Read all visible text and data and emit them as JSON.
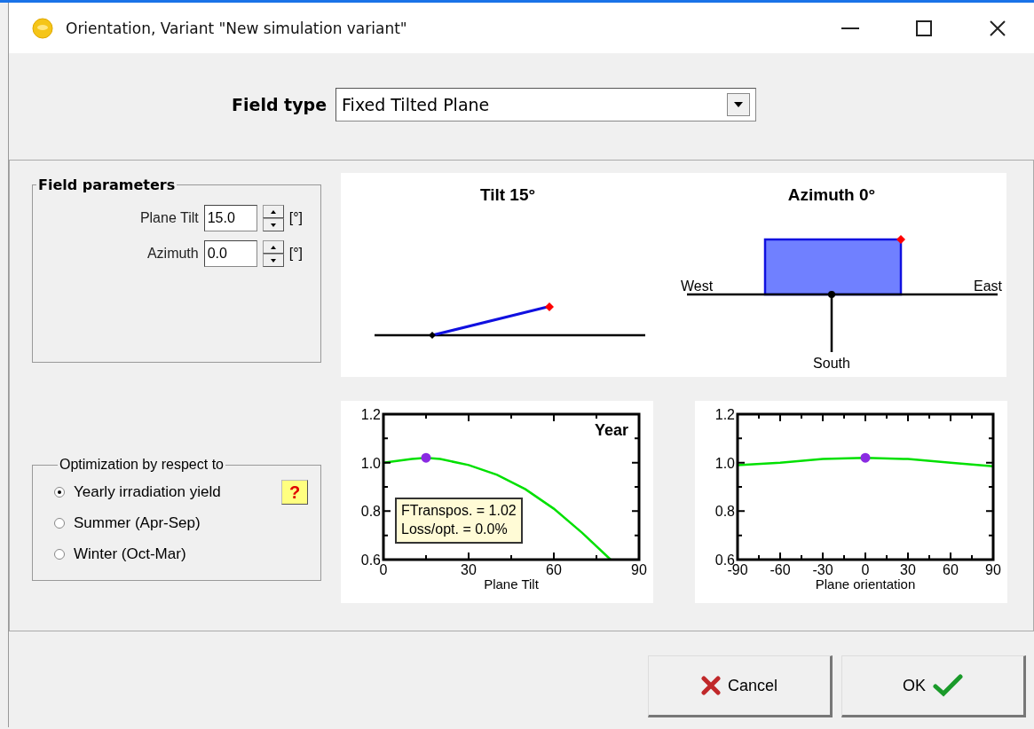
{
  "window": {
    "title": "Orientation, Variant \"New simulation variant\""
  },
  "field_type": {
    "label": "Field type",
    "value": "Fixed Tilted Plane"
  },
  "field_parameters": {
    "title": "Field parameters",
    "rows": [
      {
        "label": "Plane Tilt",
        "value": "15.0",
        "unit": "[°]"
      },
      {
        "label": "Azimuth",
        "value": "0.0",
        "unit": "[°]"
      }
    ]
  },
  "optimization": {
    "title": "Optimization by respect to",
    "help": "?",
    "options": [
      {
        "label": "Yearly irradiation yield",
        "selected": true
      },
      {
        "label": "Summer (Apr-Sep)",
        "selected": false
      },
      {
        "label": "Winter (Oct-Mar)",
        "selected": false
      }
    ]
  },
  "tilt_diagram": {
    "title": "Tilt 15°"
  },
  "azimuth_diagram": {
    "title": "Azimuth 0°",
    "west": "West",
    "east": "East",
    "south": "South"
  },
  "tilt_chart": {
    "tag": "Year",
    "info": [
      "FTranspos. = 1.02",
      "Loss/opt. = 0.0%"
    ],
    "chart_data": {
      "type": "line",
      "xlabel": "Plane Tilt",
      "x": [
        0,
        10,
        15,
        20,
        30,
        40,
        50,
        60,
        70,
        80
      ],
      "series": [
        {
          "color": "#00e000",
          "values": [
            1.0,
            1.015,
            1.02,
            1.015,
            0.99,
            0.95,
            0.89,
            0.81,
            0.71,
            0.6
          ]
        }
      ],
      "xlim": [
        0,
        90
      ],
      "ylim": [
        0.6,
        1.2
      ],
      "xticks": [
        0,
        30,
        60,
        90
      ],
      "yticks": [
        {
          "value": 0.6,
          "label": "0.6"
        },
        {
          "value": 0.8,
          "label": "0.8"
        },
        {
          "value": 1.0,
          "label": "1.0"
        },
        {
          "value": 1.2,
          "label": "1.2"
        }
      ]
    }
  },
  "azimuth_chart": {
    "chart_data": {
      "type": "line",
      "xlabel": "Plane orientation",
      "x": [
        -90,
        -60,
        -30,
        0,
        30,
        60,
        90
      ],
      "series": [
        {
          "color": "#00e000",
          "values": [
            0.99,
            1.0,
            1.015,
            1.02,
            1.015,
            1.0,
            0.985
          ]
        }
      ],
      "xlim": [
        -90,
        90
      ],
      "ylim": [
        0.6,
        1.2
      ],
      "xticks": [
        -90,
        -60,
        -30,
        0,
        30,
        60,
        90
      ],
      "yticks": [
        {
          "value": 0.6,
          "label": "0.6"
        },
        {
          "value": 0.8,
          "label": "0.8"
        },
        {
          "value": 1.0,
          "label": "1.0"
        },
        {
          "value": 1.2,
          "label": "1.2"
        }
      ]
    }
  },
  "buttons": [
    {
      "label": "Cancel",
      "kind": "cancel"
    },
    {
      "label": "OK",
      "kind": "ok"
    }
  ]
}
